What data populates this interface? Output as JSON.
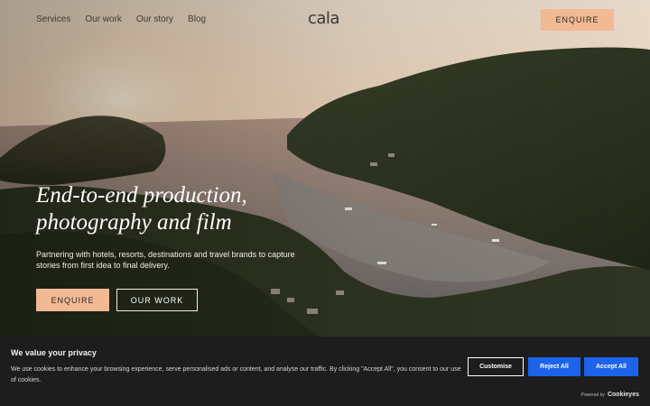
{
  "header": {
    "nav": [
      "Services",
      "Our work",
      "Our story",
      "Blog"
    ],
    "logo": "cala",
    "enquire_label": "ENQUIRE"
  },
  "hero": {
    "headline_line1": "End-to-end production,",
    "headline_line2": "photography and film",
    "subline": "Partnering with hotels, resorts, destinations and travel brands to capture stories from first idea to final delivery.",
    "enquire_label": "ENQUIRE",
    "work_label": "OUR WORK"
  },
  "cookie": {
    "title": "We value your privacy",
    "text": "We use cookies to enhance your browsing experience, serve personalised ads or content, and analyse our traffic. By clicking \"Accept All\", you consent to our use of cookies.",
    "customise_label": "Customise",
    "reject_label": "Reject All",
    "accept_label": "Accept All",
    "powered_by": "Powered by",
    "powered_brand": "Cookieyes"
  },
  "colors": {
    "accent": "#f1b994",
    "cookie_bg": "#1d1d1d",
    "cookie_button": "#1c63ea"
  }
}
